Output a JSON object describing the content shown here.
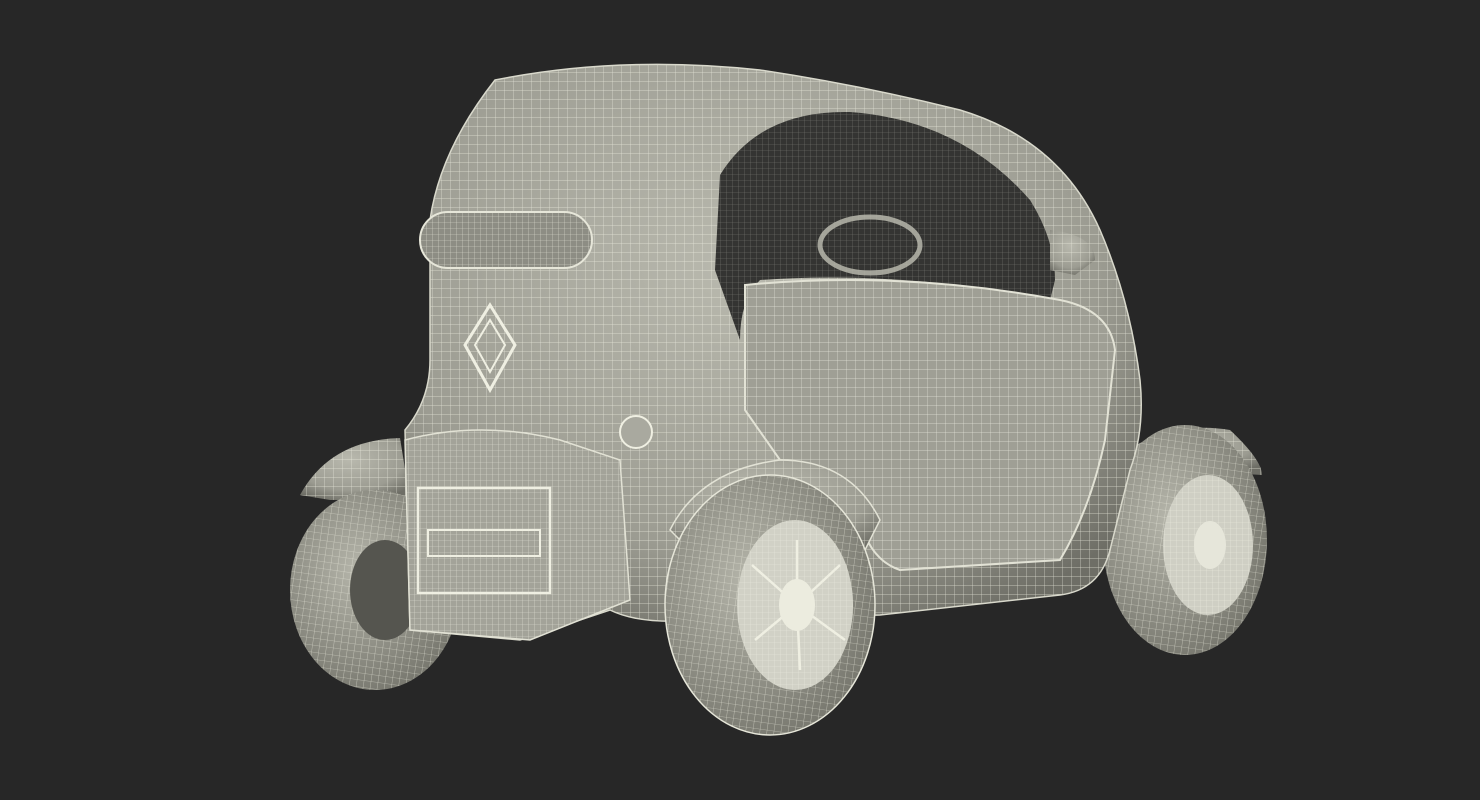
{
  "scene": {
    "subject": "wireframe-electric-microcar",
    "colors": {
      "background": "#272727",
      "surface": "#9c9c92",
      "surface_light": "#b9b9ae",
      "surface_dark": "#6e6e66",
      "wire": "#efefe2",
      "interior": "#343432"
    }
  }
}
